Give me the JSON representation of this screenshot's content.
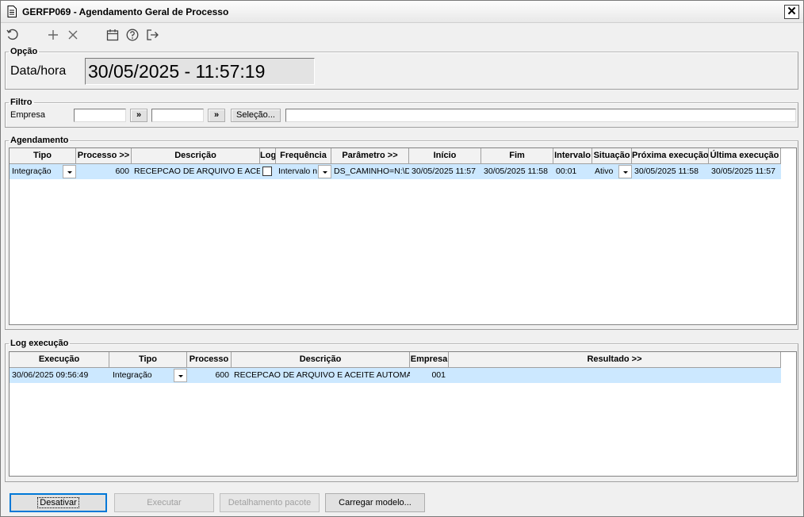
{
  "window": {
    "title": "GERFP069 - Agendamento Geral de Processo",
    "close_glyph": "✕"
  },
  "toolbar": {
    "icons": [
      "refresh-icon",
      "add-icon",
      "delete-icon",
      "calendar-icon",
      "help-icon",
      "exit-icon"
    ]
  },
  "opcao": {
    "legend": "Opção",
    "datahora_label": "Data/hora",
    "datahora_value": "30/05/2025  -  11:57:19"
  },
  "filtro": {
    "legend": "Filtro",
    "empresa_label": "Empresa",
    "empresa_from": "",
    "empresa_to": "",
    "btn_expand": "»",
    "btn_selecao": "Seleção...",
    "selecao_text": ""
  },
  "agendamento": {
    "legend": "Agendamento",
    "columns": [
      "Tipo",
      "Processo >>",
      "Descrição",
      "Log",
      "Frequência",
      "Parâmetro >>",
      "Início",
      "Fim",
      "Intervalo",
      "Situação",
      "Próxima execução",
      "Última execução"
    ],
    "rows": [
      {
        "tipo": "Integração",
        "processo": "600",
        "descricao": "RECEPCAO DE ARQUIVO E ACEITE AUTOMATICO",
        "log": false,
        "frequencia": "Intervalo n",
        "parametro": "DS_CAMINHO=N:\\D",
        "inicio": "30/05/2025 11:57",
        "fim": "30/05/2025 11:58",
        "intervalo": "00:01",
        "situacao": "Ativo",
        "proxima": "30/05/2025 11:58",
        "ultima": "30/05/2025 11:57"
      }
    ]
  },
  "log": {
    "legend": "Log execução",
    "columns": [
      "Execução",
      "Tipo",
      "Processo",
      "Descrição",
      "Empresa",
      "Resultado >>"
    ],
    "rows": [
      {
        "execucao": "30/06/2025 09:56:49",
        "tipo": "Integração",
        "processo": "600",
        "descricao": "RECEPCAO DE ARQUIVO E ACEITE AUTOMATICO",
        "empresa": "001",
        "resultado": ""
      }
    ]
  },
  "buttons": {
    "desativar": "Desativar",
    "executar": "Executar",
    "detalhamento": "Detalhamento pacote",
    "carregar": "Carregar modelo..."
  }
}
